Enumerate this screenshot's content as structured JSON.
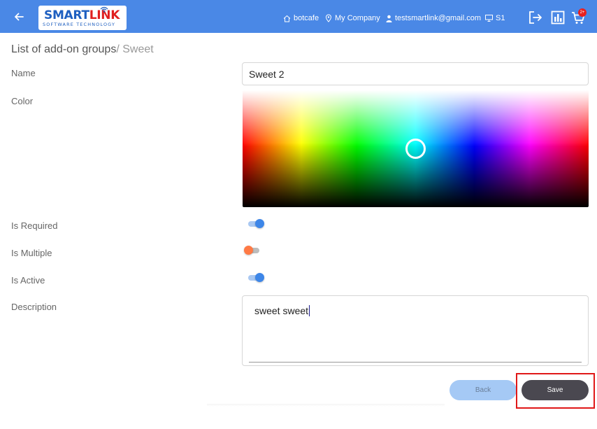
{
  "header": {
    "logo_main_a": "SMART",
    "logo_main_b": "LINK",
    "logo_sub": "SOFTWARE TECHNOLOGY",
    "store": "botcafe",
    "company": "My Company",
    "user": "testsmartlink@gmail.com",
    "station": "S1",
    "cart_badge": "2+",
    "bar_color": "#4a88e6"
  },
  "breadcrumb": {
    "root": "List of add-on groups",
    "current": "/ Sweet"
  },
  "form": {
    "name_label": "Name",
    "name_value": "Sweet 2",
    "color_label": "Color",
    "is_required_label": "Is Required",
    "is_required": true,
    "is_multiple_label": "Is Multiple",
    "is_multiple": false,
    "is_active_label": "Is Active",
    "is_active": true,
    "description_label": "Description",
    "description_value": "sweet sweet"
  },
  "actions": {
    "back_label": "Back",
    "save_label": "Save"
  }
}
